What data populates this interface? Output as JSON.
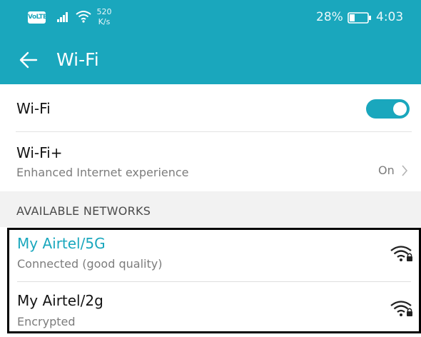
{
  "status_bar": {
    "volte": "VoLTE",
    "speed_value": "520",
    "speed_unit": "K/s",
    "battery": "28%",
    "time": "4:03"
  },
  "app_bar": {
    "title": "Wi-Fi"
  },
  "wifi_row": {
    "label": "Wi-Fi",
    "enabled": true
  },
  "wifi_plus": {
    "label": "Wi-Fi+",
    "subtitle": "Enhanced Internet experience",
    "value": "On"
  },
  "section": {
    "title": "AVAILABLE NETWORKS"
  },
  "networks": [
    {
      "name": "My Airtel/5G",
      "status": "Connected (good quality)"
    },
    {
      "name": "My Airtel/2g",
      "status": "Encrypted"
    }
  ],
  "colors": {
    "accent": "#1aa7bd",
    "section_bg": "#f2f2f2"
  }
}
